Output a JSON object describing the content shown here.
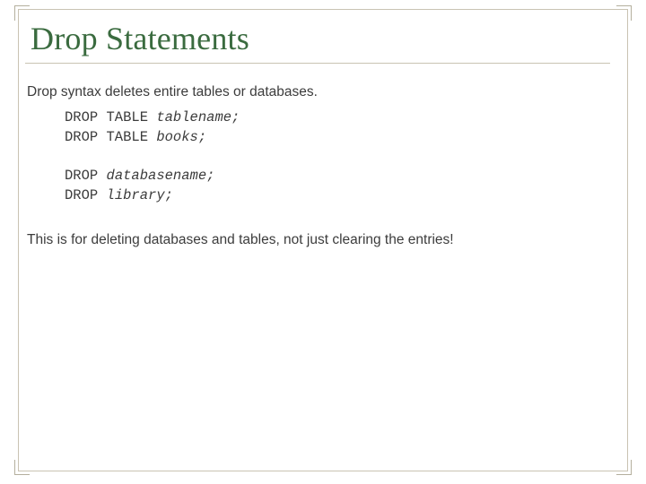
{
  "title": "Drop Statements",
  "intro": "Drop syntax deletes entire tables or databases.",
  "code": {
    "l1_kw": "DROP TABLE ",
    "l1_arg": "tablename;",
    "l2_kw": "DROP TABLE ",
    "l2_arg": "books;",
    "l3_kw": "DROP ",
    "l3_arg": "databasename;",
    "l4_kw": "DROP ",
    "l4_arg": "library;"
  },
  "note": "This is for deleting databases and tables, not just clearing the entries!"
}
